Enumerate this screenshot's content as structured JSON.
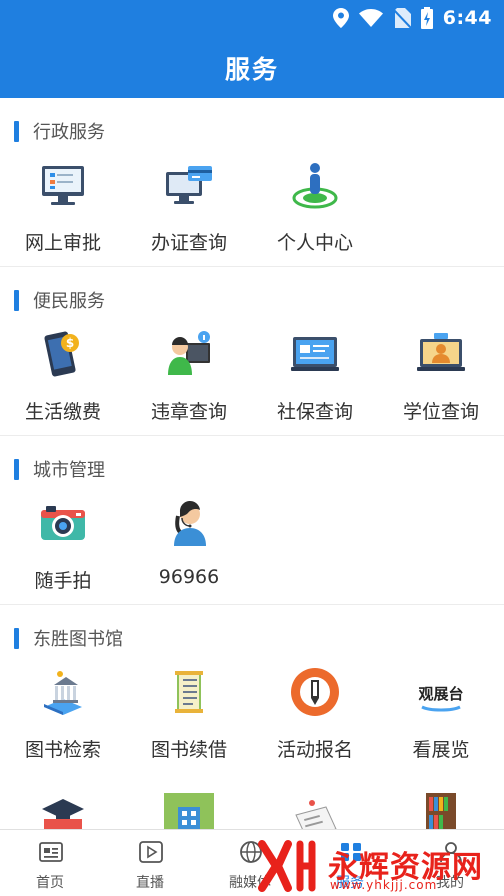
{
  "status_bar": {
    "time": "6:44",
    "icons": [
      "location-icon",
      "wifi-icon",
      "no-sim-icon",
      "battery-charging-icon"
    ]
  },
  "header": {
    "title": "服务"
  },
  "sections": [
    {
      "title": "行政服务",
      "items": [
        {
          "label": "网上审批",
          "icon": "online-approval-icon"
        },
        {
          "label": "办证查询",
          "icon": "certificate-query-icon"
        },
        {
          "label": "个人中心",
          "icon": "personal-center-icon"
        }
      ]
    },
    {
      "title": "便民服务",
      "items": [
        {
          "label": "生活缴费",
          "icon": "bill-payment-icon"
        },
        {
          "label": "违章查询",
          "icon": "violation-query-icon"
        },
        {
          "label": "社保查询",
          "icon": "social-security-icon"
        },
        {
          "label": "学位查询",
          "icon": "degree-query-icon"
        }
      ]
    },
    {
      "title": "城市管理",
      "items": [
        {
          "label": "随手拍",
          "icon": "camera-icon"
        },
        {
          "label": "96966",
          "icon": "hotline-operator-icon"
        }
      ]
    },
    {
      "title": "东胜图书馆",
      "items": [
        {
          "label": "图书检索",
          "icon": "book-search-icon"
        },
        {
          "label": "图书续借",
          "icon": "book-renew-icon"
        },
        {
          "label": "活动报名",
          "icon": "event-signup-icon"
        },
        {
          "label": "看展览",
          "icon": "exhibition-icon",
          "icon_text": "观展台"
        },
        {
          "label": "",
          "icon": "graduation-books-icon"
        },
        {
          "label": "",
          "icon": "building-icon"
        },
        {
          "label": "",
          "icon": "newspaper-icon"
        },
        {
          "label": "",
          "icon": "bookshelf-icon"
        }
      ]
    }
  ],
  "tabbar": {
    "tabs": [
      {
        "label": "首页",
        "icon": "home-news-icon"
      },
      {
        "label": "直播",
        "icon": "live-play-icon"
      },
      {
        "label": "融媒体",
        "icon": "media-globe-icon"
      },
      {
        "label": "服务",
        "icon": "service-icon",
        "active": true
      },
      {
        "label": "我的",
        "icon": "profile-icon"
      }
    ]
  },
  "watermark": {
    "text": "永辉资源网",
    "url": "www.yhkjjj.com"
  },
  "colors": {
    "primary": "#1f7fe0",
    "divider": "#ececec",
    "watermark": "#e8221b"
  }
}
